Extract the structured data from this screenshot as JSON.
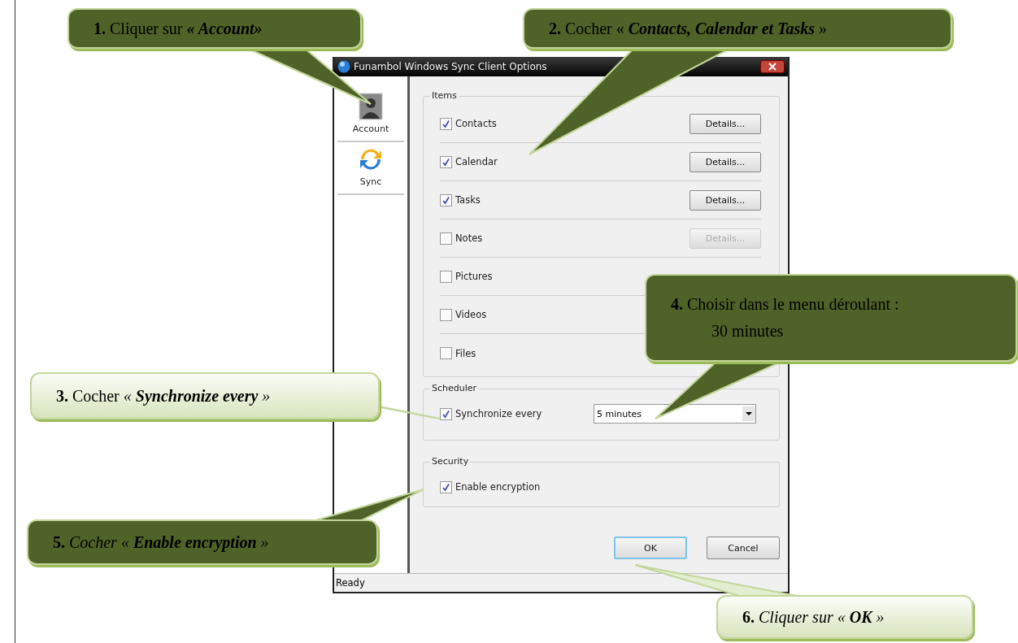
{
  "window": {
    "title": "Funambol Windows Sync Client Options"
  },
  "sidebar": {
    "items": [
      {
        "label": "Account",
        "kind": "account"
      },
      {
        "label": "Sync",
        "kind": "sync"
      }
    ]
  },
  "items_group": {
    "title": "Items",
    "items": [
      {
        "label": "Contacts",
        "checked": true,
        "details": {
          "label": "Details...",
          "disabled": false
        }
      },
      {
        "label": "Calendar",
        "checked": true,
        "details": {
          "label": "Details...",
          "disabled": false
        }
      },
      {
        "label": "Tasks",
        "checked": true,
        "details": {
          "label": "Details...",
          "disabled": false
        }
      },
      {
        "label": "Notes",
        "checked": false,
        "details": {
          "label": "Details...",
          "disabled": true
        }
      },
      {
        "label": "Pictures",
        "checked": false
      },
      {
        "label": "Videos",
        "checked": false
      },
      {
        "label": "Files",
        "checked": false
      }
    ]
  },
  "scheduler": {
    "title": "Scheduler",
    "label": "Synchronize every",
    "checked": true,
    "value": "5 minutes"
  },
  "security": {
    "title": "Security",
    "label": "Enable encryption",
    "checked": true
  },
  "buttons": [
    {
      "label": "OK",
      "default": true
    },
    {
      "label": "Cancel",
      "default": false
    }
  ],
  "status_bar": "Ready",
  "callouts": [
    {
      "kind": "dark",
      "lines": [
        "**1.** Cliquer sur **« Account»**"
      ]
    },
    {
      "kind": "dark",
      "lines": [
        "**2.** Cocher « **Contacts, Calendar et Tasks** »"
      ]
    },
    {
      "kind": "light",
      "lines": [
        "**3.** Cocher *«* **Synchronize every** *»*"
      ]
    },
    {
      "kind": "dark",
      "lines": [
        "**4.** Choisir dans le menu déroulant :",
        "30 minutes"
      ]
    },
    {
      "kind": "dark",
      "lines": [
        "**5.** *Cocher «* **Enable encryption** *»*"
      ]
    },
    {
      "kind": "light",
      "lines": [
        "**6.** *Cliquer sur  «* **OK** *»*"
      ]
    }
  ]
}
